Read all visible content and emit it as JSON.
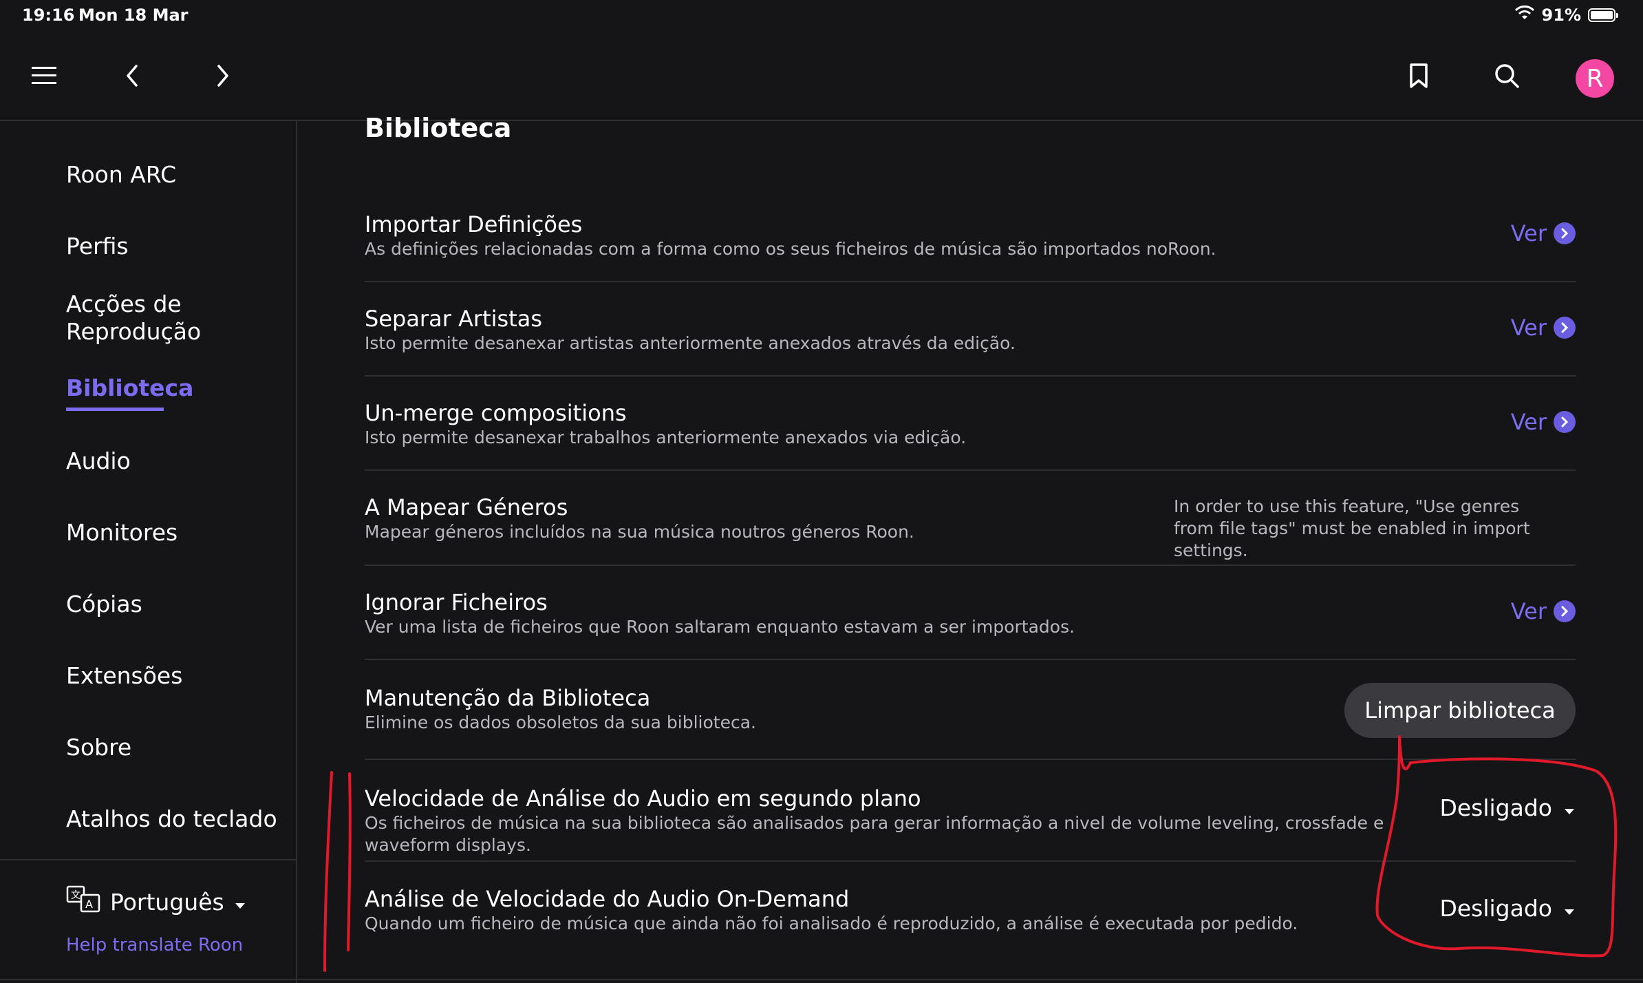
{
  "status_bar": {
    "time": "19:16",
    "date": "Mon 18 Mar",
    "battery": "91%"
  },
  "icons": {
    "menu": "hamburger-menu-icon",
    "back": "chevron-left-icon",
    "forward": "chevron-right-icon",
    "bookmark": "bookmark-icon",
    "search": "search-icon",
    "language": "translate-icon",
    "ver": "arrow-right-circle-icon",
    "dropdown": "caret-down-icon"
  },
  "avatar": {
    "letter": "R",
    "color": "#f347a3"
  },
  "accent_color": "#7b6cf0",
  "sidebar": {
    "items": [
      {
        "label": "Roon ARC"
      },
      {
        "label": "Perfis"
      },
      {
        "label": "Acções de Reprodução"
      },
      {
        "label": "Biblioteca",
        "active": true
      },
      {
        "label": "Audio"
      },
      {
        "label": "Monitores"
      },
      {
        "label": "Cópias"
      },
      {
        "label": "Extensões"
      },
      {
        "label": "Sobre"
      },
      {
        "label": "Atalhos do teclado"
      }
    ],
    "language": "Português",
    "help_link": "Help translate Roon"
  },
  "main": {
    "title": "Biblioteca",
    "rows": [
      {
        "title": "Importar Definições",
        "desc": "As definições relacionadas com a forma como os seus ficheiros de música são importados noRoon.",
        "action": "Ver"
      },
      {
        "title": "Separar Artistas",
        "desc": "Isto permite desanexar artistas anteriormente anexados através da edição.",
        "action": "Ver"
      },
      {
        "title": "Un-merge compositions",
        "desc": "Isto permite desanexar trabalhos anteriormente anexados via edição.",
        "action": "Ver"
      },
      {
        "title": "A Mapear Géneros",
        "desc": "Mapear géneros incluídos na sua música noutros géneros Roon.",
        "note": "In order to use this feature, \"Use genres from file tags\" must be enabled in import settings."
      },
      {
        "title": "Ignorar Ficheiros",
        "desc": "Ver uma lista de ficheiros que Roon saltaram enquanto estavam a ser importados.",
        "action": "Ver"
      },
      {
        "title": "Manutenção da Biblioteca",
        "desc": "Elimine os dados obsoletos da sua biblioteca.",
        "button": "Limpar biblioteca"
      },
      {
        "title": "Velocidade de Análise do Audio em segundo plano",
        "desc": "Os ficheiros de música na sua biblioteca são analisados para gerar informação a nivel de volume leveling, crossfade e waveform displays.",
        "dropdown": "Desligado"
      },
      {
        "title": "Análise de Velocidade do Audio On-Demand",
        "desc": "Quando um ficheiro de música que ainda não foi analisado é reproduzido, a análise é executada por pedido.",
        "dropdown": "Desligado"
      }
    ]
  },
  "annotation_color": "#e0192b"
}
